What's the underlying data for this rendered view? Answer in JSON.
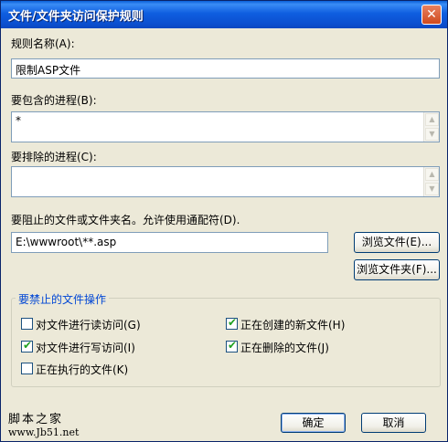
{
  "window": {
    "title": "文件/文件夹访问保护规则",
    "close_glyph": "✕"
  },
  "rule_name": {
    "label": "规则名称(A):",
    "value": "限制ASP文件"
  },
  "include_processes": {
    "label": "要包含的进程(B):",
    "value": "*"
  },
  "exclude_processes": {
    "label": "要排除的进程(C):",
    "value": ""
  },
  "block_target": {
    "label": "要阻止的文件或文件夹名。允许使用通配符(D).",
    "value": "E:\\wwwroot\\**.asp"
  },
  "buttons": {
    "browse_file": "浏览文件(E)...",
    "browse_folder": "浏览文件夹(F)...",
    "ok": "确定",
    "cancel": "取消"
  },
  "operations": {
    "title": "要禁止的文件操作",
    "items": [
      {
        "label": "对文件进行读访问(G)",
        "checked": false
      },
      {
        "label": "正在创建的新文件(H)",
        "checked": true
      },
      {
        "label": "对文件进行写访问(I)",
        "checked": true
      },
      {
        "label": "正在删除的文件(J)",
        "checked": true
      },
      {
        "label": "正在执行的文件(K)",
        "checked": false
      }
    ]
  },
  "watermark": {
    "line1": "脚本之家",
    "line2": "www.Jb51.net"
  },
  "colors": {
    "titlebar": "#0b4fcf",
    "group_title": "#0046d5",
    "check": "#21a121"
  }
}
